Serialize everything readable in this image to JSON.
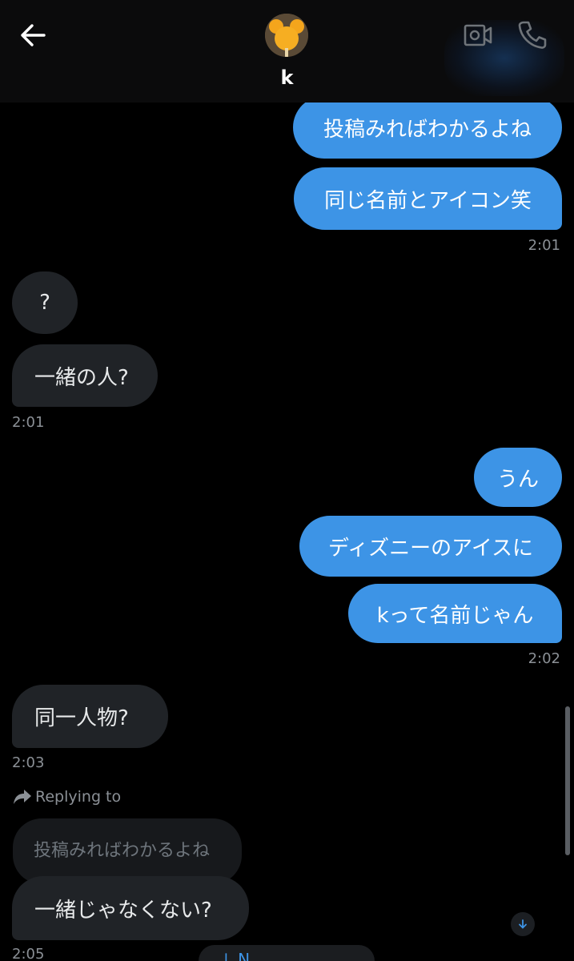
{
  "header": {
    "contact_name": "k",
    "back_icon": "arrow-left-icon",
    "video_icon": "video-camera-icon",
    "call_icon": "phone-icon",
    "avatar": "avatar"
  },
  "messages": [
    {
      "text": "投稿みればわかるよね"
    },
    {
      "text": "同じ名前とアイコン笑"
    },
    {
      "time": "2:01"
    },
    {
      "text": "?"
    },
    {
      "text": "一緒の人?"
    },
    {
      "time": "2:01"
    },
    {
      "text": "うん"
    },
    {
      "text": "ディズニーのアイスに"
    },
    {
      "text": "kって名前じゃん"
    },
    {
      "time": "2:02"
    },
    {
      "text": "同一人物?"
    },
    {
      "time": "2:03"
    },
    {
      "reply_label": "Replying to",
      "quoted": "投稿みればわかるよね"
    },
    {
      "text": "一緒じゃなくない?"
    },
    {
      "time": "2:05"
    }
  ],
  "new_messages_pill": "↓ N",
  "colors": {
    "outgoing_bubble": "#3d94e6",
    "incoming_bubble": "#202327",
    "background": "#000000",
    "timestamp": "#8b9096"
  }
}
